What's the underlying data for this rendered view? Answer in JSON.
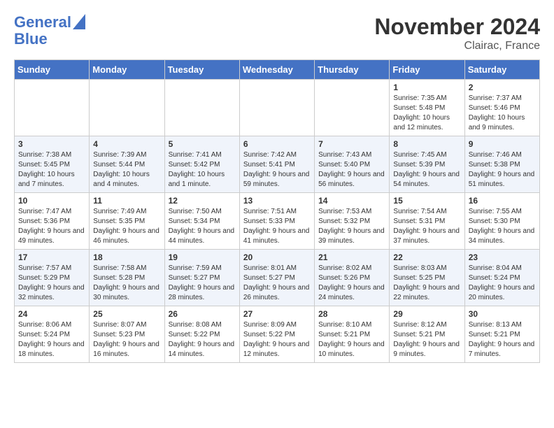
{
  "header": {
    "logo_line1": "General",
    "logo_line2": "Blue",
    "month_title": "November 2024",
    "location": "Clairac, France"
  },
  "weekdays": [
    "Sunday",
    "Monday",
    "Tuesday",
    "Wednesday",
    "Thursday",
    "Friday",
    "Saturday"
  ],
  "weeks": [
    [
      {
        "day": "",
        "info": ""
      },
      {
        "day": "",
        "info": ""
      },
      {
        "day": "",
        "info": ""
      },
      {
        "day": "",
        "info": ""
      },
      {
        "day": "",
        "info": ""
      },
      {
        "day": "1",
        "info": "Sunrise: 7:35 AM\nSunset: 5:48 PM\nDaylight: 10 hours and 12 minutes."
      },
      {
        "day": "2",
        "info": "Sunrise: 7:37 AM\nSunset: 5:46 PM\nDaylight: 10 hours and 9 minutes."
      }
    ],
    [
      {
        "day": "3",
        "info": "Sunrise: 7:38 AM\nSunset: 5:45 PM\nDaylight: 10 hours and 7 minutes."
      },
      {
        "day": "4",
        "info": "Sunrise: 7:39 AM\nSunset: 5:44 PM\nDaylight: 10 hours and 4 minutes."
      },
      {
        "day": "5",
        "info": "Sunrise: 7:41 AM\nSunset: 5:42 PM\nDaylight: 10 hours and 1 minute."
      },
      {
        "day": "6",
        "info": "Sunrise: 7:42 AM\nSunset: 5:41 PM\nDaylight: 9 hours and 59 minutes."
      },
      {
        "day": "7",
        "info": "Sunrise: 7:43 AM\nSunset: 5:40 PM\nDaylight: 9 hours and 56 minutes."
      },
      {
        "day": "8",
        "info": "Sunrise: 7:45 AM\nSunset: 5:39 PM\nDaylight: 9 hours and 54 minutes."
      },
      {
        "day": "9",
        "info": "Sunrise: 7:46 AM\nSunset: 5:38 PM\nDaylight: 9 hours and 51 minutes."
      }
    ],
    [
      {
        "day": "10",
        "info": "Sunrise: 7:47 AM\nSunset: 5:36 PM\nDaylight: 9 hours and 49 minutes."
      },
      {
        "day": "11",
        "info": "Sunrise: 7:49 AM\nSunset: 5:35 PM\nDaylight: 9 hours and 46 minutes."
      },
      {
        "day": "12",
        "info": "Sunrise: 7:50 AM\nSunset: 5:34 PM\nDaylight: 9 hours and 44 minutes."
      },
      {
        "day": "13",
        "info": "Sunrise: 7:51 AM\nSunset: 5:33 PM\nDaylight: 9 hours and 41 minutes."
      },
      {
        "day": "14",
        "info": "Sunrise: 7:53 AM\nSunset: 5:32 PM\nDaylight: 9 hours and 39 minutes."
      },
      {
        "day": "15",
        "info": "Sunrise: 7:54 AM\nSunset: 5:31 PM\nDaylight: 9 hours and 37 minutes."
      },
      {
        "day": "16",
        "info": "Sunrise: 7:55 AM\nSunset: 5:30 PM\nDaylight: 9 hours and 34 minutes."
      }
    ],
    [
      {
        "day": "17",
        "info": "Sunrise: 7:57 AM\nSunset: 5:29 PM\nDaylight: 9 hours and 32 minutes."
      },
      {
        "day": "18",
        "info": "Sunrise: 7:58 AM\nSunset: 5:28 PM\nDaylight: 9 hours and 30 minutes."
      },
      {
        "day": "19",
        "info": "Sunrise: 7:59 AM\nSunset: 5:27 PM\nDaylight: 9 hours and 28 minutes."
      },
      {
        "day": "20",
        "info": "Sunrise: 8:01 AM\nSunset: 5:27 PM\nDaylight: 9 hours and 26 minutes."
      },
      {
        "day": "21",
        "info": "Sunrise: 8:02 AM\nSunset: 5:26 PM\nDaylight: 9 hours and 24 minutes."
      },
      {
        "day": "22",
        "info": "Sunrise: 8:03 AM\nSunset: 5:25 PM\nDaylight: 9 hours and 22 minutes."
      },
      {
        "day": "23",
        "info": "Sunrise: 8:04 AM\nSunset: 5:24 PM\nDaylight: 9 hours and 20 minutes."
      }
    ],
    [
      {
        "day": "24",
        "info": "Sunrise: 8:06 AM\nSunset: 5:24 PM\nDaylight: 9 hours and 18 minutes."
      },
      {
        "day": "25",
        "info": "Sunrise: 8:07 AM\nSunset: 5:23 PM\nDaylight: 9 hours and 16 minutes."
      },
      {
        "day": "26",
        "info": "Sunrise: 8:08 AM\nSunset: 5:22 PM\nDaylight: 9 hours and 14 minutes."
      },
      {
        "day": "27",
        "info": "Sunrise: 8:09 AM\nSunset: 5:22 PM\nDaylight: 9 hours and 12 minutes."
      },
      {
        "day": "28",
        "info": "Sunrise: 8:10 AM\nSunset: 5:21 PM\nDaylight: 9 hours and 10 minutes."
      },
      {
        "day": "29",
        "info": "Sunrise: 8:12 AM\nSunset: 5:21 PM\nDaylight: 9 hours and 9 minutes."
      },
      {
        "day": "30",
        "info": "Sunrise: 8:13 AM\nSunset: 5:21 PM\nDaylight: 9 hours and 7 minutes."
      }
    ]
  ]
}
